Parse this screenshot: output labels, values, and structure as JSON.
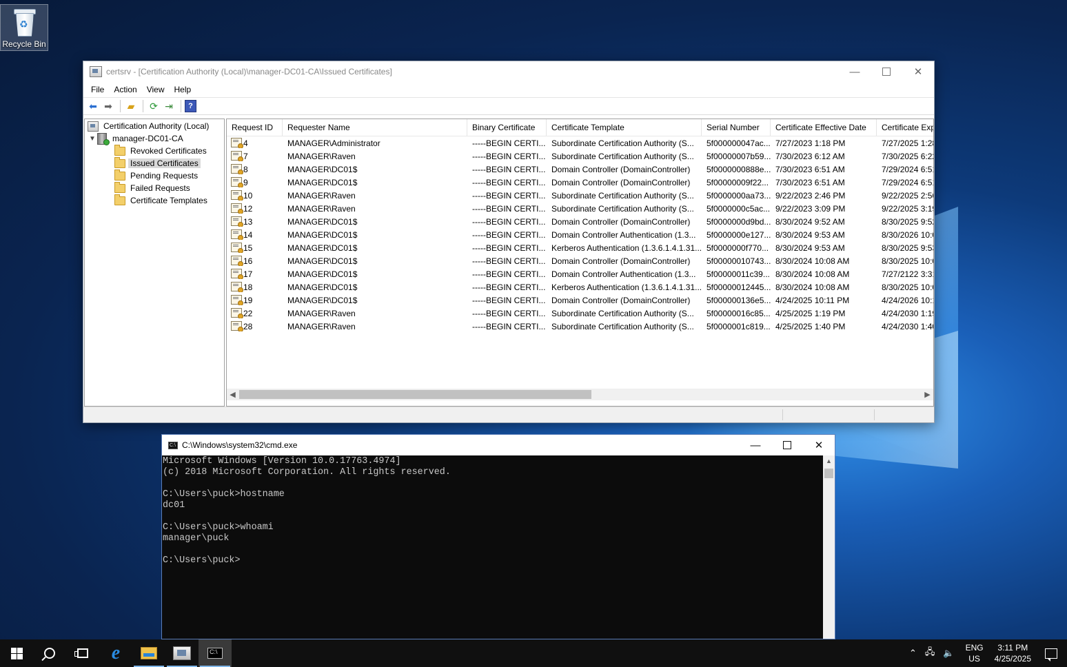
{
  "desktop": {
    "recycle_bin_label": "Recycle Bin"
  },
  "mmc": {
    "title": "certsrv - [Certification Authority (Local)\\manager-DC01-CA\\Issued Certificates]",
    "menu": [
      "File",
      "Action",
      "View",
      "Help"
    ],
    "toolbar_icons": [
      "back-arrow-icon",
      "forward-arrow-icon",
      "up-folder-icon",
      "refresh-icon",
      "export-list-icon",
      "help-icon"
    ],
    "tree": {
      "root": "Certification Authority (Local)",
      "ca": "manager-DC01-CA",
      "children": [
        "Revoked Certificates",
        "Issued Certificates",
        "Pending Requests",
        "Failed Requests",
        "Certificate Templates"
      ],
      "selected": "Issued Certificates"
    },
    "columns": [
      "Request ID",
      "Requester Name",
      "Binary Certificate",
      "Certificate Template",
      "Serial Number",
      "Certificate Effective Date",
      "Certificate Exp"
    ],
    "rows": [
      [
        "4",
        "MANAGER\\Administrator",
        "-----BEGIN CERTI...",
        "Subordinate Certification Authority (S...",
        "5f000000047ac...",
        "7/27/2023 1:18 PM",
        "7/27/2025 1:28"
      ],
      [
        "7",
        "MANAGER\\Raven",
        "-----BEGIN CERTI...",
        "Subordinate Certification Authority (S...",
        "5f00000007b59...",
        "7/30/2023 6:12 AM",
        "7/30/2025 6:22"
      ],
      [
        "8",
        "MANAGER\\DC01$",
        "-----BEGIN CERTI...",
        "Domain Controller (DomainController)",
        "5f0000000888e...",
        "7/30/2023 6:51 AM",
        "7/29/2024 6:51"
      ],
      [
        "9",
        "MANAGER\\DC01$",
        "-----BEGIN CERTI...",
        "Domain Controller (DomainController)",
        "5f00000009f22...",
        "7/30/2023 6:51 AM",
        "7/29/2024 6:51"
      ],
      [
        "10",
        "MANAGER\\Raven",
        "-----BEGIN CERTI...",
        "Subordinate Certification Authority (S...",
        "5f0000000aa73...",
        "9/22/2023 2:46 PM",
        "9/22/2025 2:56"
      ],
      [
        "12",
        "MANAGER\\Raven",
        "-----BEGIN CERTI...",
        "Subordinate Certification Authority (S...",
        "5f0000000c5ac...",
        "9/22/2023 3:09 PM",
        "9/22/2025 3:19"
      ],
      [
        "13",
        "MANAGER\\DC01$",
        "-----BEGIN CERTI...",
        "Domain Controller (DomainController)",
        "5f0000000d9bd...",
        "8/30/2024 9:52 AM",
        "8/30/2025 9:52"
      ],
      [
        "14",
        "MANAGER\\DC01$",
        "-----BEGIN CERTI...",
        "Domain Controller Authentication (1.3...",
        "5f0000000e127...",
        "8/30/2024 9:53 AM",
        "8/30/2026 10:0"
      ],
      [
        "15",
        "MANAGER\\DC01$",
        "-----BEGIN CERTI...",
        "Kerberos Authentication (1.3.6.1.4.1.31...",
        "5f0000000f770...",
        "8/30/2024 9:53 AM",
        "8/30/2025 9:53"
      ],
      [
        "16",
        "MANAGER\\DC01$",
        "-----BEGIN CERTI...",
        "Domain Controller (DomainController)",
        "5f00000010743...",
        "8/30/2024 10:08 AM",
        "8/30/2025 10:0"
      ],
      [
        "17",
        "MANAGER\\DC01$",
        "-----BEGIN CERTI...",
        "Domain Controller Authentication (1.3...",
        "5f00000011c39...",
        "8/30/2024 10:08 AM",
        "7/27/2122 3:31"
      ],
      [
        "18",
        "MANAGER\\DC01$",
        "-----BEGIN CERTI...",
        "Kerberos Authentication (1.3.6.1.4.1.31...",
        "5f00000012445...",
        "8/30/2024 10:08 AM",
        "8/30/2025 10:0"
      ],
      [
        "19",
        "MANAGER\\DC01$",
        "-----BEGIN CERTI...",
        "Domain Controller (DomainController)",
        "5f000000136e5...",
        "4/24/2025 10:11 PM",
        "4/24/2026 10:1"
      ],
      [
        "22",
        "MANAGER\\Raven",
        "-----BEGIN CERTI...",
        "Subordinate Certification Authority (S...",
        "5f00000016c85...",
        "4/25/2025 1:19 PM",
        "4/24/2030 1:19"
      ],
      [
        "28",
        "MANAGER\\Raven",
        "-----BEGIN CERTI...",
        "Subordinate Certification Authority (S...",
        "5f0000001c819...",
        "4/25/2025 1:40 PM",
        "4/24/2030 1:40"
      ]
    ]
  },
  "cmd": {
    "title": "C:\\Windows\\system32\\cmd.exe",
    "icon_text": "C:\\",
    "lines": [
      "Microsoft Windows [Version 10.0.17763.4974]",
      "(c) 2018 Microsoft Corporation. All rights reserved.",
      "",
      "C:\\Users\\puck>hostname",
      "dc01",
      "",
      "C:\\Users\\puck>whoami",
      "manager\\puck",
      "",
      "C:\\Users\\puck>"
    ]
  },
  "window_controls": {
    "minimize": "—",
    "close": "✕"
  },
  "taskbar": {
    "ie_glyph": "e",
    "cmd_glyph": "C:\\",
    "tray": {
      "chevron": "⌃",
      "network_icon": "🖧",
      "volume_icon": "🔈",
      "lang_top": "ENG",
      "lang_bottom": "US",
      "time": "3:11 PM",
      "date": "4/25/2025"
    }
  }
}
